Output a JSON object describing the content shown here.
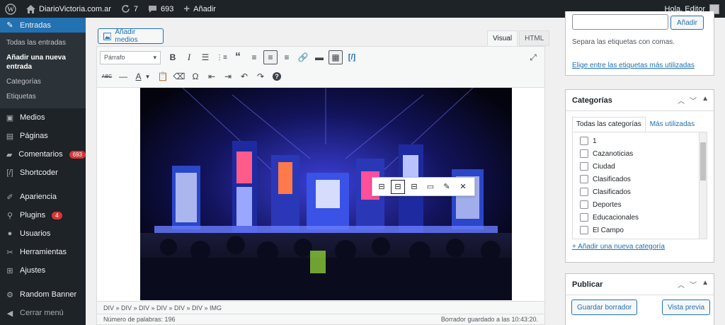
{
  "adminbar": {
    "site_name": "DiarioVictoria.com.ar",
    "updates_count": "7",
    "comments_count": "693",
    "new_label": "Añadir",
    "greeting": "Hola, Editor"
  },
  "sidebar": {
    "current_menu": "Entradas",
    "submenu": [
      "Todas las entradas",
      "Añadir una nueva entrada",
      "Categorías",
      "Etiquetas"
    ],
    "items": [
      {
        "label": "Medios",
        "icon": "media-icon"
      },
      {
        "label": "Páginas",
        "icon": "pages-icon"
      },
      {
        "label": "Comentarios",
        "icon": "comments-icon",
        "badge": "693"
      },
      {
        "label": "Shortcoder",
        "icon": "shortcoder-icon"
      },
      {
        "label": "Apariencia",
        "icon": "appearance-icon"
      },
      {
        "label": "Plugins",
        "icon": "plugins-icon",
        "badge": "4"
      },
      {
        "label": "Usuarios",
        "icon": "users-icon"
      },
      {
        "label": "Herramientas",
        "icon": "tools-icon"
      },
      {
        "label": "Ajustes",
        "icon": "settings-icon"
      },
      {
        "label": "Random Banner",
        "icon": "gear-icon"
      },
      {
        "label": "Cerrar menú",
        "icon": "collapse-icon"
      }
    ]
  },
  "editor": {
    "add_media_label": "Añadir medios",
    "tab_visual": "Visual",
    "tab_html": "HTML",
    "format_select": "Párrafo",
    "path": "DIV » DIV » DIV » DIV » DIV » DIV » IMG",
    "word_count": "Número de palabras: 196",
    "draft_saved": "Borrador guardado a las 10:43:20."
  },
  "tags_box": {
    "add_button": "Añadir",
    "help_text": "Separa las etiquetas con comas.",
    "choose_link": "Elige entre las etiquetas más utilizadas"
  },
  "categories_box": {
    "title": "Categorías",
    "tab_all": "Todas las categorías",
    "tab_most_used": "Más utilizadas",
    "items": [
      "1",
      "Cazanoticias",
      "Ciudad",
      "Clasificados",
      "Clasificados",
      "Deportes",
      "Educacionales",
      "El Campo"
    ],
    "add_link": "+ Añadir una nueva categoría"
  },
  "publish_box": {
    "title": "Publicar",
    "save_draft": "Guardar borrador",
    "preview": "Vista previa"
  },
  "colors": {
    "admin_dark": "#1d2327",
    "accent_blue": "#2271b1",
    "badge_red": "#d63638"
  }
}
